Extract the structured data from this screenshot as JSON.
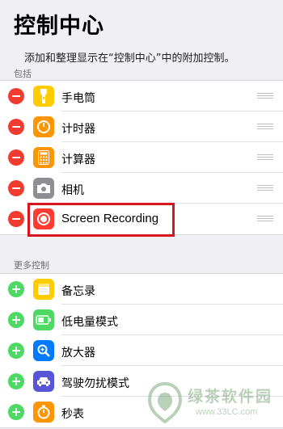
{
  "header": {
    "title": "控制中心",
    "description": "添加和整理显示在“控制中心”中的附加控制。"
  },
  "included": {
    "section_label": "包括",
    "items": [
      {
        "label": "手电筒",
        "icon": "flashlight-icon",
        "color": "#ffcc00"
      },
      {
        "label": "计时器",
        "icon": "timer-icon",
        "color": "#ff9500"
      },
      {
        "label": "计算器",
        "icon": "calculator-icon",
        "color": "#ff9500"
      },
      {
        "label": "相机",
        "icon": "camera-icon",
        "color": "#8e8e93"
      },
      {
        "label": "Screen Recording",
        "icon": "screen-recording-icon",
        "color": "#ff3b30"
      }
    ]
  },
  "more": {
    "section_label": "更多控制",
    "items": [
      {
        "label": "备忘录",
        "icon": "notes-icon",
        "color": "#ffcc00"
      },
      {
        "label": "低电量模式",
        "icon": "low-power-mode-icon",
        "color": "#4cd964"
      },
      {
        "label": "放大器",
        "icon": "magnifier-icon",
        "color": "#007aff"
      },
      {
        "label": "驾驶勿扰模式",
        "icon": "car-icon",
        "color": "#5856d6"
      },
      {
        "label": "秒表",
        "icon": "stopwatch-icon",
        "color": "#ff9500"
      }
    ]
  },
  "watermark": {
    "brand": "绿茶软件园",
    "url": "www.33LC.com"
  },
  "colors": {
    "remove": "#f23b30",
    "add": "#4cd964",
    "highlight": "#d7151e",
    "background": "#efeff4"
  }
}
